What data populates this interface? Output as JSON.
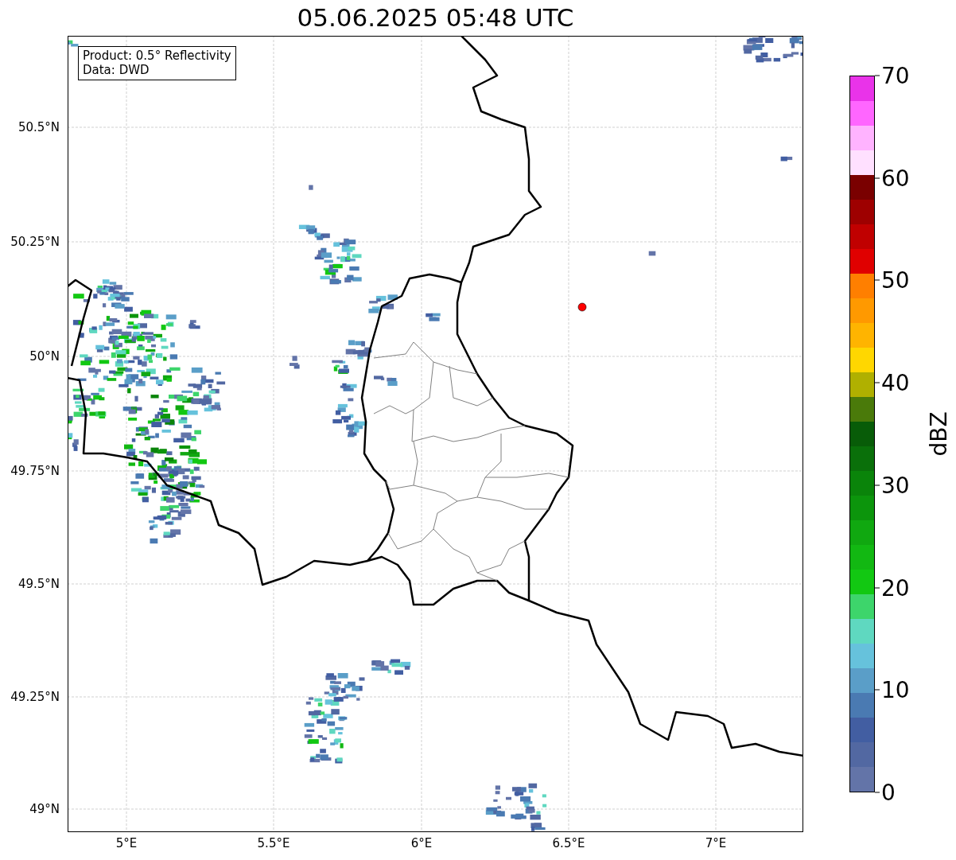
{
  "title": "05.06.2025 05:48 UTC",
  "map": {
    "info_box": [
      "Product: 0.5° Reflectivity",
      "Data: DWD"
    ],
    "y_ticks": [
      "50.5°N",
      "50.25°N",
      "50°N",
      "49.75°N",
      "49.5°N",
      "49.25°N",
      "49°N"
    ],
    "x_ticks": [
      "5°E",
      "5.5°E",
      "6°E",
      "6.5°E",
      "7°E"
    ]
  },
  "colorbar": {
    "label": "dBZ",
    "ticks": [
      "70",
      "60",
      "50",
      "40",
      "30",
      "20",
      "10",
      "0"
    ],
    "bins": [
      {
        "color": "#6374a8"
      },
      {
        "color": "#5268a2"
      },
      {
        "color": "#425ea2"
      },
      {
        "color": "#4a7ab2"
      },
      {
        "color": "#5a9ec8"
      },
      {
        "color": "#66c2dc"
      },
      {
        "color": "#5fd8c0"
      },
      {
        "color": "#3dd56b"
      },
      {
        "color": "#12c812"
      },
      {
        "color": "#12b812"
      },
      {
        "color": "#10a810"
      },
      {
        "color": "#0c950c"
      },
      {
        "color": "#0a840a"
      },
      {
        "color": "#0a700a"
      },
      {
        "color": "#085c08"
      },
      {
        "color": "#4a7a0a"
      },
      {
        "color": "#b0b000"
      },
      {
        "color": "#ffd700"
      },
      {
        "color": "#ffb400"
      },
      {
        "color": "#ff9900"
      },
      {
        "color": "#ff7f00"
      },
      {
        "color": "#e00000"
      },
      {
        "color": "#c00000"
      },
      {
        "color": "#9e0000"
      },
      {
        "color": "#7a0000"
      },
      {
        "color": "#ffe0ff"
      },
      {
        "color": "#ffb3ff"
      },
      {
        "color": "#ff66ff"
      },
      {
        "color": "#e933e9"
      }
    ]
  }
}
